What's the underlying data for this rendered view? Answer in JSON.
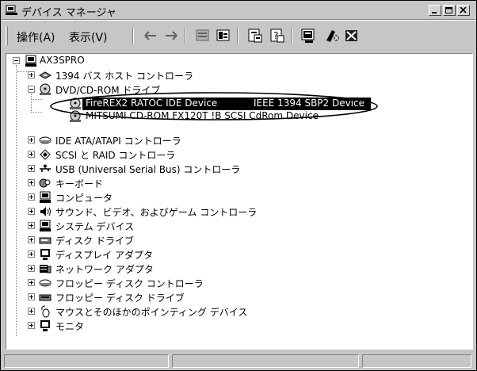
{
  "window": {
    "title": "デバイス マネージャ",
    "controls": [
      "minimize",
      "maximize",
      "close"
    ]
  },
  "toolbar": {
    "menus": [
      "操作(A)",
      "表示(V)"
    ],
    "buttons": [
      "back-icon",
      "forward-icon",
      "properties-icon",
      "scope-icon",
      "view-properties-icon",
      "help-icon",
      "scan-hardware-icon",
      "uninstall-icon",
      "disable-icon"
    ]
  },
  "tree": {
    "root": "AX3SPRO",
    "nodes": [
      {
        "label": "1394 バス ホスト コントローラ",
        "icon": "bus-controller-icon",
        "expanded": false
      },
      {
        "label": "DVD/CD-ROM ドライブ",
        "icon": "dvd-cdrom-icon",
        "expanded": true,
        "children": [
          {
            "label": "FireREX2 RATOC IDE Device",
            "label2": "IEEE 1394 SBP2 Device",
            "icon": "cdrom-device-icon",
            "selected": true
          },
          {
            "label": "MITSUMI CD-ROM FX120T !B SCSI CdRom Device",
            "icon": "cdrom-device-icon"
          }
        ]
      },
      {
        "label": "IDE ATA/ATAPI コントローラ",
        "icon": "ide-controller-icon",
        "expanded": false
      },
      {
        "label": "SCSI と RAID コントローラ",
        "icon": "scsi-controller-icon",
        "expanded": false
      },
      {
        "label": "USB (Universal Serial Bus) コントローラ",
        "icon": "usb-icon",
        "expanded": false
      },
      {
        "label": "キーボード",
        "icon": "keyboard-icon",
        "expanded": false
      },
      {
        "label": "コンピュータ",
        "icon": "computer-icon",
        "expanded": false
      },
      {
        "label": "サウンド、ビデオ、およびゲーム コントローラ",
        "icon": "sound-icon",
        "expanded": false
      },
      {
        "label": "システム デバイス",
        "icon": "system-device-icon",
        "expanded": false
      },
      {
        "label": "ディスク ドライブ",
        "icon": "disk-drive-icon",
        "expanded": false
      },
      {
        "label": "ディスプレイ アダプタ",
        "icon": "display-adapter-icon",
        "expanded": false
      },
      {
        "label": "ネットワーク アダプタ",
        "icon": "network-adapter-icon",
        "expanded": false
      },
      {
        "label": "フロッピー ディスク コントローラ",
        "icon": "floppy-controller-icon",
        "expanded": false
      },
      {
        "label": "フロッピー ディスク ドライブ",
        "icon": "floppy-drive-icon",
        "expanded": false
      },
      {
        "label": "マウスとそのほかのポインティング デバイス",
        "icon": "mouse-icon",
        "expanded": false
      },
      {
        "label": "モニタ",
        "icon": "monitor-icon",
        "expanded": false
      }
    ]
  },
  "statusbar": {
    "panels": [
      "",
      "",
      ""
    ]
  },
  "colors": {
    "chrome": "#c6c6c6",
    "highlight": "#000000",
    "annotation": "#000000"
  }
}
